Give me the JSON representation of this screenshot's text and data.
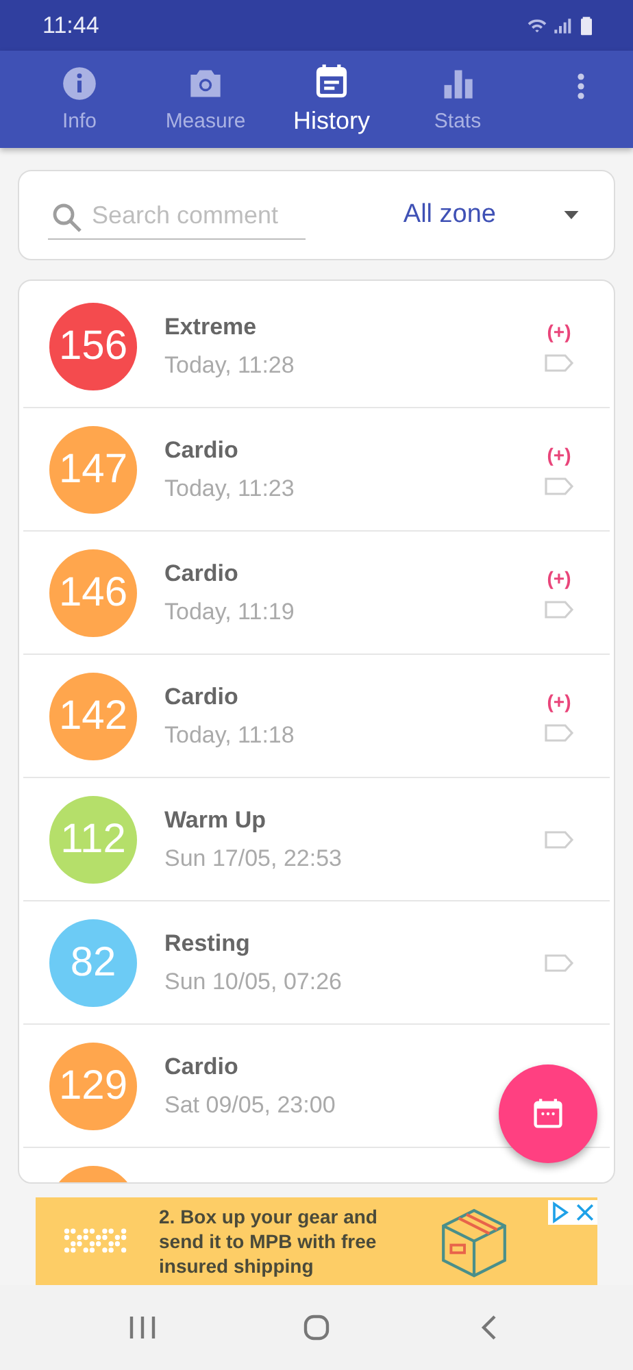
{
  "status_bar": {
    "time": "11:44"
  },
  "tabs": [
    {
      "label": "Info",
      "selected": false
    },
    {
      "label": "Measure",
      "selected": false
    },
    {
      "label": "History",
      "selected": true
    },
    {
      "label": "Stats",
      "selected": false
    }
  ],
  "search": {
    "placeholder": "Search comment",
    "zone_filter": "All zone"
  },
  "entries": [
    {
      "value": "156",
      "zone": "Extreme",
      "time": "Today, 11:28",
      "color": "#f44b4e",
      "plus": "(+)"
    },
    {
      "value": "147",
      "zone": "Cardio",
      "time": "Today, 11:23",
      "color": "#ffa64d",
      "plus": "(+)"
    },
    {
      "value": "146",
      "zone": "Cardio",
      "time": "Today, 11:19",
      "color": "#ffa64d",
      "plus": "(+)"
    },
    {
      "value": "142",
      "zone": "Cardio",
      "time": "Today, 11:18",
      "color": "#ffa64d",
      "plus": "(+)"
    },
    {
      "value": "112",
      "zone": "Warm Up",
      "time": "Sun 17/05, 22:53",
      "color": "#b5df6a"
    },
    {
      "value": "82",
      "zone": "Resting",
      "time": "Sun 10/05, 07:26",
      "color": "#6ccbf5"
    },
    {
      "value": "129",
      "zone": "Cardio",
      "time": "Sat 09/05, 23:00",
      "color": "#ffa64d",
      "tag": false
    },
    {
      "color": "#ffa64d"
    }
  ],
  "ad": {
    "text": "2. Box up your gear and send it to MPB with free insured shipping"
  }
}
